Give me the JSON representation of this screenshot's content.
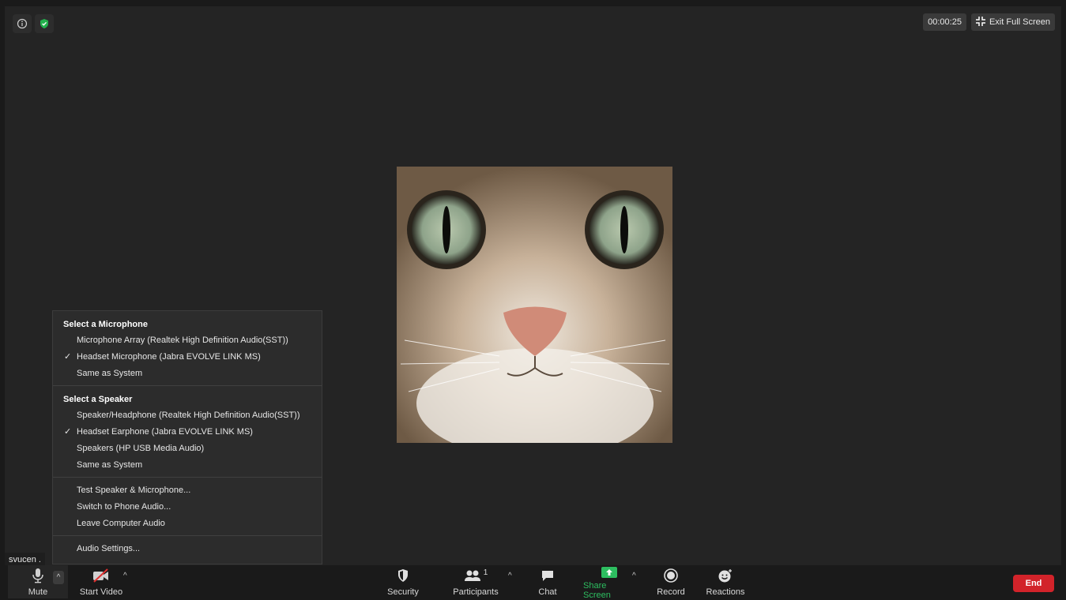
{
  "status": {
    "info_icon": "info-icon",
    "security_icon": "shield-check-icon",
    "timer": "00:00:25",
    "exit_fullscreen_label": "Exit Full Screen"
  },
  "participant": {
    "name": "svucen ."
  },
  "audio_menu": {
    "microphone_heading": "Select a Microphone",
    "microphones": [
      {
        "label": "Microphone Array (Realtek High Definition Audio(SST))",
        "checked": false
      },
      {
        "label": "Headset Microphone (Jabra EVOLVE LINK MS)",
        "checked": true
      },
      {
        "label": "Same as System",
        "checked": false
      }
    ],
    "speaker_heading": "Select a Speaker",
    "speakers": [
      {
        "label": "Speaker/Headphone (Realtek High Definition Audio(SST))",
        "checked": false
      },
      {
        "label": "Headset Earphone (Jabra EVOLVE LINK MS)",
        "checked": true
      },
      {
        "label": "Speakers (HP USB Media Audio)",
        "checked": false
      },
      {
        "label": "Same as System",
        "checked": false
      }
    ],
    "actions": [
      "Test Speaker & Microphone...",
      "Switch to Phone Audio...",
      "Leave Computer Audio"
    ],
    "settings": "Audio Settings...",
    "check_mark": "✓"
  },
  "toolbar": {
    "mute": "Mute",
    "start_video": "Start Video",
    "security": "Security",
    "participants": "Participants",
    "participants_count": "1",
    "chat": "Chat",
    "share_screen": "Share Screen",
    "record": "Record",
    "reactions": "Reactions",
    "end": "End",
    "caret": "^"
  },
  "colors": {
    "share_green": "#2dbe60",
    "end_red": "#d2232a",
    "shield_green": "#22b14c"
  }
}
